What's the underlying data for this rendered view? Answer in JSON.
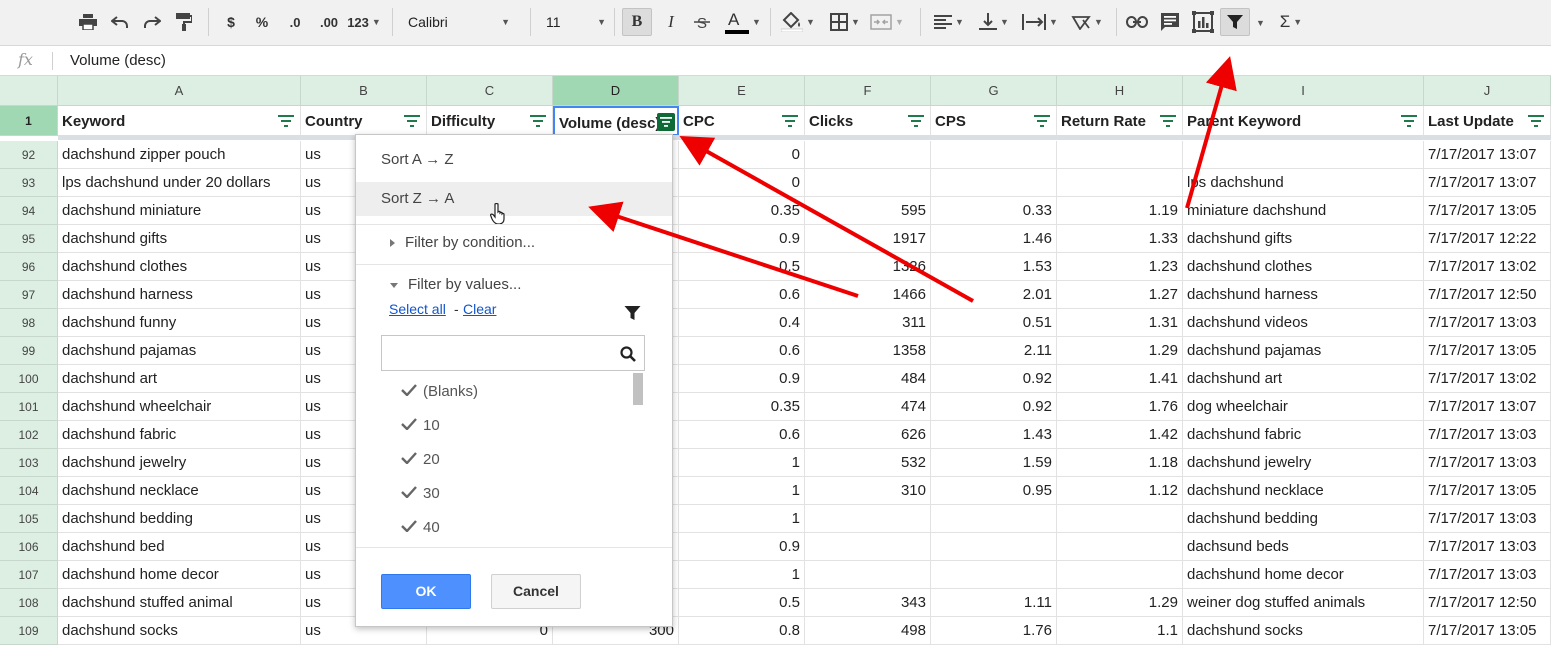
{
  "toolbar": {
    "font_name": "Calibri",
    "font_size": "11",
    "currency": "$",
    "percent": "%",
    "decrease_decimals": ".0",
    "increase_decimals": ".00",
    "more_formats": "123",
    "bold": "B",
    "italic": "I",
    "text_color": "A",
    "sum": "Σ"
  },
  "formula_bar": {
    "fx": "fx",
    "value": "Volume (desc)"
  },
  "columns": [
    "A",
    "B",
    "C",
    "D",
    "E",
    "F",
    "G",
    "H",
    "I",
    "J"
  ],
  "header_row_number": "1",
  "headers": [
    "Keyword",
    "Country",
    "Difficulty",
    "Volume (desc)",
    "CPC",
    "Clicks",
    "CPS",
    "Return Rate",
    "Parent Keyword",
    "Last Update"
  ],
  "rows": [
    {
      "n": "92",
      "keyword": "dachshund zipper pouch",
      "country": "us",
      "difficulty": "",
      "volume": "",
      "cpc": "0",
      "clicks": "",
      "cps": "",
      "return_rate": "",
      "parent": "",
      "updated": "7/17/2017 13:07"
    },
    {
      "n": "93",
      "keyword": "lps dachshund under 20 dollars",
      "country": "us",
      "difficulty": "",
      "volume": "",
      "cpc": "0",
      "clicks": "",
      "cps": "",
      "return_rate": "",
      "parent": "lps dachshund",
      "updated": "7/17/2017 13:07"
    },
    {
      "n": "94",
      "keyword": "dachshund miniature",
      "country": "us",
      "difficulty": "",
      "volume": "",
      "cpc": "0.35",
      "clicks": "595",
      "cps": "0.33",
      "return_rate": "1.19",
      "parent": "miniature dachshund",
      "updated": "7/17/2017 13:05"
    },
    {
      "n": "95",
      "keyword": "dachshund gifts",
      "country": "us",
      "difficulty": "",
      "volume": "",
      "cpc": "0.9",
      "clicks": "1917",
      "cps": "1.46",
      "return_rate": "1.33",
      "parent": "dachshund gifts",
      "updated": "7/17/2017 12:22"
    },
    {
      "n": "96",
      "keyword": "dachshund clothes",
      "country": "us",
      "difficulty": "",
      "volume": "",
      "cpc": "0.5",
      "clicks": "1326",
      "cps": "1.53",
      "return_rate": "1.23",
      "parent": "dachshund clothes",
      "updated": "7/17/2017 13:02"
    },
    {
      "n": "97",
      "keyword": "dachshund harness",
      "country": "us",
      "difficulty": "",
      "volume": "",
      "cpc": "0.6",
      "clicks": "1466",
      "cps": "2.01",
      "return_rate": "1.27",
      "parent": "dachshund harness",
      "updated": "7/17/2017 12:50"
    },
    {
      "n": "98",
      "keyword": "dachshund funny",
      "country": "us",
      "difficulty": "",
      "volume": "",
      "cpc": "0.4",
      "clicks": "311",
      "cps": "0.51",
      "return_rate": "1.31",
      "parent": "dachshund videos",
      "updated": "7/17/2017 13:03"
    },
    {
      "n": "99",
      "keyword": "dachshund pajamas",
      "country": "us",
      "difficulty": "",
      "volume": "",
      "cpc": "0.6",
      "clicks": "1358",
      "cps": "2.11",
      "return_rate": "1.29",
      "parent": "dachshund pajamas",
      "updated": "7/17/2017 13:05"
    },
    {
      "n": "100",
      "keyword": "dachshund art",
      "country": "us",
      "difficulty": "",
      "volume": "",
      "cpc": "0.9",
      "clicks": "484",
      "cps": "0.92",
      "return_rate": "1.41",
      "parent": "dachshund art",
      "updated": "7/17/2017 13:02"
    },
    {
      "n": "101",
      "keyword": "dachshund wheelchair",
      "country": "us",
      "difficulty": "",
      "volume": "",
      "cpc": "0.35",
      "clicks": "474",
      "cps": "0.92",
      "return_rate": "1.76",
      "parent": "dog wheelchair",
      "updated": "7/17/2017 13:07"
    },
    {
      "n": "102",
      "keyword": "dachshund fabric",
      "country": "us",
      "difficulty": "",
      "volume": "",
      "cpc": "0.6",
      "clicks": "626",
      "cps": "1.43",
      "return_rate": "1.42",
      "parent": "dachshund fabric",
      "updated": "7/17/2017 13:03"
    },
    {
      "n": "103",
      "keyword": "dachshund jewelry",
      "country": "us",
      "difficulty": "",
      "volume": "",
      "cpc": "1",
      "clicks": "532",
      "cps": "1.59",
      "return_rate": "1.18",
      "parent": "dachshund jewelry",
      "updated": "7/17/2017 13:03"
    },
    {
      "n": "104",
      "keyword": "dachshund necklace",
      "country": "us",
      "difficulty": "",
      "volume": "",
      "cpc": "1",
      "clicks": "310",
      "cps": "0.95",
      "return_rate": "1.12",
      "parent": "dachshund necklace",
      "updated": "7/17/2017 13:05"
    },
    {
      "n": "105",
      "keyword": "dachshund bedding",
      "country": "us",
      "difficulty": "",
      "volume": "",
      "cpc": "1",
      "clicks": "",
      "cps": "",
      "return_rate": "",
      "parent": "dachshund bedding",
      "updated": "7/17/2017 13:03"
    },
    {
      "n": "106",
      "keyword": "dachshund bed",
      "country": "us",
      "difficulty": "",
      "volume": "",
      "cpc": "0.9",
      "clicks": "",
      "cps": "",
      "return_rate": "",
      "parent": "dachsund beds",
      "updated": "7/17/2017 13:03"
    },
    {
      "n": "107",
      "keyword": "dachshund home decor",
      "country": "us",
      "difficulty": "",
      "volume": "",
      "cpc": "1",
      "clicks": "",
      "cps": "",
      "return_rate": "",
      "parent": "dachshund home decor",
      "updated": "7/17/2017 13:03"
    },
    {
      "n": "108",
      "keyword": "dachshund stuffed animal",
      "country": "us",
      "difficulty": "",
      "volume": "",
      "cpc": "0.5",
      "clicks": "343",
      "cps": "1.11",
      "return_rate": "1.29",
      "parent": "weiner dog stuffed animals",
      "updated": "7/17/2017 12:50"
    },
    {
      "n": "109",
      "keyword": "dachshund socks",
      "country": "us",
      "difficulty": "0",
      "volume": "300",
      "cpc": "0.8",
      "clicks": "498",
      "cps": "1.76",
      "return_rate": "1.1",
      "parent": "dachshund socks",
      "updated": "7/17/2017 13:05"
    }
  ],
  "filter_menu": {
    "sort_asc": "Sort A → Z",
    "sort_desc": "Sort Z → A",
    "filter_by_condition": "Filter by condition...",
    "filter_by_values": "Filter by values...",
    "select_all": "Select all",
    "separator": "-",
    "clear": "Clear",
    "search_value": "",
    "values": [
      "(Blanks)",
      "10",
      "20",
      "30",
      "40"
    ],
    "ok": "OK",
    "cancel": "Cancel"
  },
  "colors": {
    "header_bg": "#ddefe3",
    "selected_header_bg": "#a0d8b4",
    "filter_active": "#0f6b36",
    "ok_button": "#4d90fe",
    "annotation_arrow": "#ee0000"
  }
}
